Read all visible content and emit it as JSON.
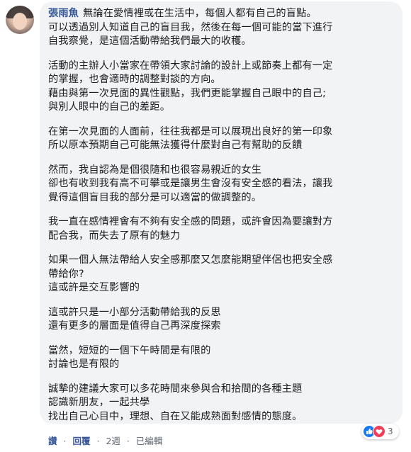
{
  "comment": {
    "author": "張雨魚",
    "paragraphs": [
      [
        "無論在愛情裡或在生活中，每個人都有自己的盲點。",
        "可以透過別人知道自己的盲目我，然後在每一個可能的當下進行",
        "自我察覺，是這個活動帶給我們最大的收穫。"
      ],
      [
        "活動的主辦人小當家在帶領大家討論的設計上或節奏上都有一定",
        "的掌握，也會適時的調整對談的方向。",
        "藉由與第一次見面的異性觀點，我們更能掌握自己眼中的自己;",
        "與別人眼中的自己的差距。"
      ],
      [
        "在第一次見面的人面前，往往我都是可以展現出良好的第一印象",
        "所以原本預期自己可能無法獲得什麼對自己有幫助的反饋"
      ],
      [
        "然而，我自認為是個很隨和也很容易親近的女生",
        "卻也有收到我有高不可攀或是讓男生會沒有安全感的看法，讓我",
        "覺得這個盲目我的部分是可以適當的做調整的。"
      ],
      [
        "我一直在感情裡會有不夠有安全感的問題，或許會因為要讓對方",
        "配合我，而失去了原有的魅力"
      ],
      [
        "如果一個人無法帶給人安全感那麼又怎麼能期望伴侶也把安全感",
        "帶給你?",
        "這或許是交互影響的"
      ],
      [
        "這或許只是一小部分活動帶給我的反思",
        "還有更多的層面是值得自己再深度探索"
      ],
      [
        "當然，短短的一個下午時間是有限的",
        "討論也是有限的"
      ],
      [
        "誠摯的建議大家可以多花時間來參與合和拾間的各種主題",
        "認識新朋友，一起共學",
        "找出自己心目中，理想、自在又能成熟面對感情的態度。"
      ]
    ]
  },
  "reactions": {
    "count": "3",
    "icons": [
      "like-icon",
      "love-icon"
    ]
  },
  "actions": {
    "like": "讚",
    "reply": "回覆",
    "time": "2週",
    "edited": "已編輯",
    "separator": "·"
  },
  "colors": {
    "bubble": "#f2f3f5",
    "author": "#385898",
    "text": "#1c1e21",
    "meta": "#606770",
    "like": "#1877f2",
    "love": "#f33e58"
  }
}
